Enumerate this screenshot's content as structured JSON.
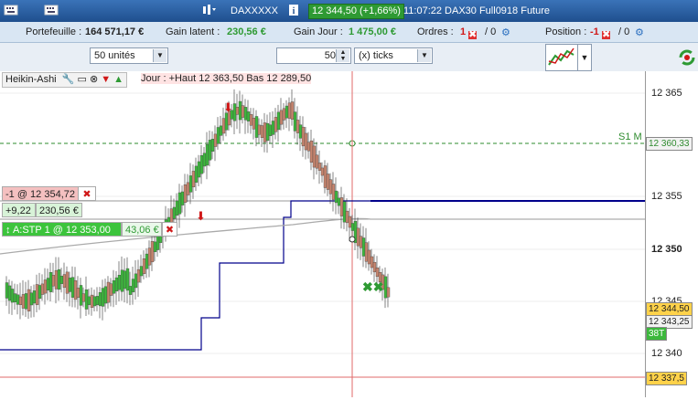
{
  "topbar": {
    "instrument": "DAXXXXX",
    "last_price": "12 344,50 (+1,66%)",
    "time_contract": "11:07:22 DAX30 Full0918 Future"
  },
  "infobar": {
    "portfolio_label": "Portefeuille :",
    "portfolio_value": "164 571,17 €",
    "latent_label": "Gain latent :",
    "latent_value": "230,56 €",
    "day_label": "Gain Jour :",
    "day_value": "1 475,00 €",
    "orders_label": "Ordres :",
    "orders_value": "1",
    "orders_sep": "/ 0",
    "position_label": "Position :",
    "position_value": "-1",
    "position_sep": "/ 0"
  },
  "toolbar": {
    "units_value": "50 unités",
    "ticks_count": "50",
    "ticks_type": "(x) ticks"
  },
  "chart": {
    "legend": "Heikin-Ashi",
    "jour_text": "Jour : +Haut 12 363,50 Bas 12 289,50",
    "s1_label": "S1 M",
    "axis_labels": [
      "12 365",
      "12 355",
      "12 350",
      "12 345",
      "12 340"
    ],
    "price_boxes": {
      "s1": "12 360,33",
      "last": "12 344,50",
      "second": "12 343,25",
      "ticks": "38T",
      "bottom": "12 337,5"
    },
    "orders": {
      "short": "-1 @ 12 354,72",
      "pnl_points": "+9,22",
      "pnl_value": "230,56 €",
      "stop": "A:STP 1 @ 12 353,00",
      "stop_pnl": "43,06 €"
    },
    "colors": {
      "up": "#3cb83c",
      "down": "#c8856e",
      "stop_line": "#00008b",
      "s1_line": "#2e8b2e",
      "crosshair": "#e06a6a"
    }
  }
}
